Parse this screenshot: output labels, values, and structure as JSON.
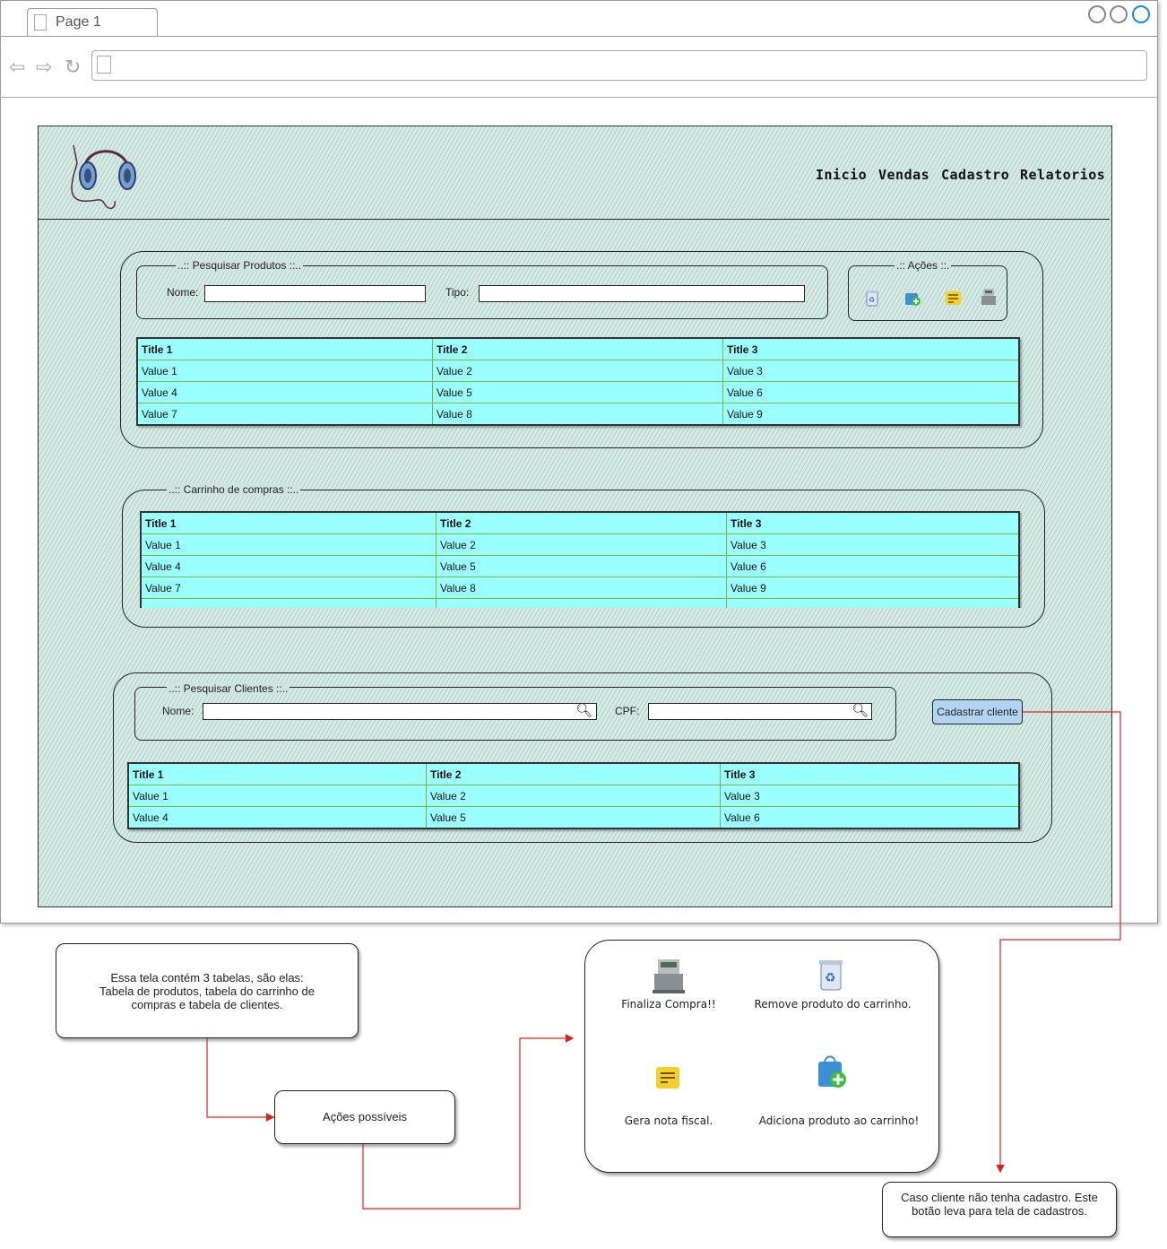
{
  "browser": {
    "tab_title": "Page 1"
  },
  "app": {
    "menu": [
      "Inicio",
      "Vendas",
      "Cadastro",
      "Relatorios"
    ]
  },
  "produtos": {
    "legend": "..:: Pesquisar Produtos ::..",
    "nome_label": "Nome:",
    "tipo_label": "Tipo:",
    "acoes_legend": ".:: Ações ::.",
    "acoes_icons": [
      "recycle-bin-icon",
      "add-to-cart-icon",
      "note-icon",
      "cash-register-icon"
    ],
    "table": {
      "headers": [
        "Title 1",
        "Title 2",
        "Title 3"
      ],
      "rows": [
        [
          "Value 1",
          "Value 2",
          "Value 3"
        ],
        [
          "Value 4",
          "Value 5",
          "Value 6"
        ],
        [
          "Value 7",
          "Value 8",
          "Value 9"
        ]
      ]
    }
  },
  "carrinho": {
    "legend": "..:: Carrinho de compras ::..",
    "table": {
      "headers": [
        "Title 1",
        "Title 2",
        "Title 3"
      ],
      "rows": [
        [
          "Value 1",
          "Value 2",
          "Value 3"
        ],
        [
          "Value 4",
          "Value 5",
          "Value 6"
        ],
        [
          "Value 7",
          "Value 8",
          "Value 9"
        ]
      ]
    }
  },
  "clientes": {
    "legend": "..:: Pesquisar Clientes ::..",
    "nome_label": "Nome:",
    "cpf_label": "CPF:",
    "cadastrar_button": "Cadastrar cliente",
    "table": {
      "headers": [
        "Title 1",
        "Title 2",
        "Title 3"
      ],
      "rows": [
        [
          "Value 1",
          "Value 2",
          "Value 3"
        ],
        [
          "Value 4",
          "Value 5",
          "Value 6"
        ]
      ]
    }
  },
  "notes": {
    "tabelas": "Essa tela contém 3 tabelas, são elas: Tabela de produtos, tabela do carrinho de compras e tabela de clientes.",
    "acoes": "Ações possíveis",
    "cadastro": "Caso cliente não tenha cadastro. Este botão leva para tela de cadastros."
  },
  "actions_legend": {
    "finaliza": "Finaliza Compra!!",
    "remove": "Remove produto do carrinho.",
    "gera": "Gera nota fiscal.",
    "adiciona": "Adiciona produto ao carrinho!"
  },
  "colors": {
    "table_bg": "#99ffff",
    "button_bg": "#b0d4f1",
    "connector": "#e02020"
  }
}
